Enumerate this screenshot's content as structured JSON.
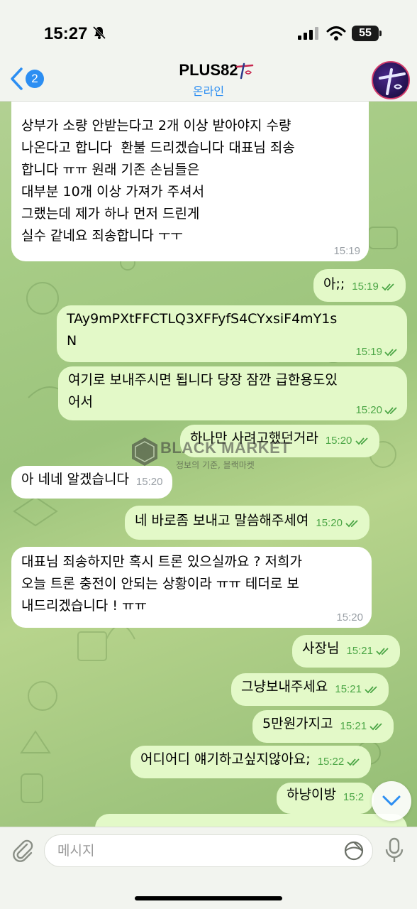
{
  "status_bar": {
    "time": "15:27",
    "battery": "55"
  },
  "header": {
    "back_count": "2",
    "title": "PLUS82",
    "status": "온라인"
  },
  "messages": [
    {
      "id": "m1",
      "direction": "in",
      "text": "상부가 소량 안받는다고 2개 이상 받아야지 수량\n나온다고 합니다  환불 드리겠습니다 대표님 죄송\n합니다 ㅠㅠ 원래 기존 손님들은\n대부분 10개 이상 가져가 주셔서\n그랬는데 제가 하나 먼저 드린게\n실수 같네요 죄송합니다 ㅜㅜ",
      "time": "15:19"
    },
    {
      "id": "m2",
      "direction": "out",
      "text": "아;;",
      "time": "15:19"
    },
    {
      "id": "m3",
      "direction": "out",
      "text": "TAy9mPXtFFCTLQ3XFFyfS4CYxsiF4mY1s\nN",
      "time": "15:19"
    },
    {
      "id": "m4",
      "direction": "out",
      "text": "여기로 보내주시면 됩니다 당장 잠깐 급한용도있\n어서",
      "time": "15:20"
    },
    {
      "id": "m5",
      "direction": "out",
      "text": "하나만 사려고했던거라",
      "time": "15:20"
    },
    {
      "id": "m6",
      "direction": "in",
      "text": "아 네네 알겠습니다",
      "time": "15:20"
    },
    {
      "id": "m7",
      "direction": "out",
      "text": "네 바로좀 보내고 말씀해주세여",
      "time": "15:20"
    },
    {
      "id": "m8",
      "direction": "in",
      "text": "대표님 죄송하지만 혹시 트론 있으실까요 ? 저희가\n오늘 트론 충전이 안되는 상황이라 ㅠㅠ 테더로 보\n내드리겠습니다 ! ㅠㅠ",
      "time": "15:20"
    },
    {
      "id": "m9",
      "direction": "out",
      "text": "사장님",
      "time": "15:21"
    },
    {
      "id": "m10",
      "direction": "out",
      "text": "그냥보내주세요",
      "time": "15:21"
    },
    {
      "id": "m11",
      "direction": "out",
      "text": "5만원가지고",
      "time": "15:21"
    },
    {
      "id": "m12",
      "direction": "out",
      "text": "어디어디 얘기하고싶지않아요;",
      "time": "15:22"
    },
    {
      "id": "m13",
      "direction": "out",
      "text": "하냥이방",
      "time": "15:2"
    }
  ],
  "watermark": {
    "title": "BLACK MARKET",
    "subtitle": "정보의 기준, 블랙마켓"
  },
  "composer": {
    "placeholder": "메시지"
  },
  "colors": {
    "accent": "#2c8ef2",
    "incoming_bubble": "#ffffff",
    "outgoing_bubble": "#e3f9c8",
    "read_check": "#4ca646"
  }
}
